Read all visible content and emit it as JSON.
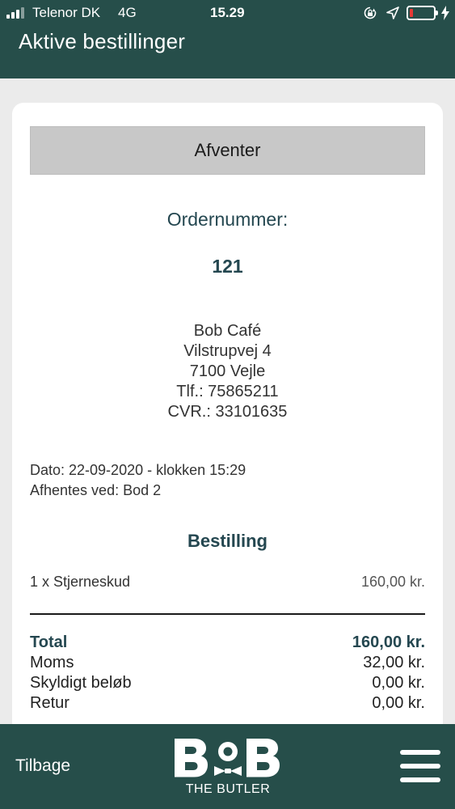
{
  "status_bar": {
    "carrier": "Telenor DK",
    "network": "4G",
    "time": "15.29",
    "battery_level": 0.15
  },
  "header": {
    "title": "Aktive bestillinger"
  },
  "order": {
    "status": "Afventer",
    "number_label": "Ordernummer:",
    "number": "121",
    "shop": {
      "name": "Bob Café",
      "street": "Vilstrupvej 4",
      "city": "7100 Vejle",
      "phone": "Tlf.: 75865211",
      "cvr": "CVR.: 33101635"
    },
    "date_line": "Dato: 22-09-2020 - klokken 15:29",
    "pickup_line": "Afhentes ved: Bod 2",
    "items_title": "Bestilling",
    "items": [
      {
        "description": "1 x Stjerneskud",
        "price": "160,00 kr."
      }
    ],
    "totals": {
      "total_label": "Total",
      "total_value": "160,00 kr.",
      "vat_label": "Moms",
      "vat_value": "32,00 kr.",
      "due_label": "Skyldigt beløb",
      "due_value": "0,00 kr.",
      "change_label": "Retur",
      "change_value": "0,00 kr."
    }
  },
  "footer": {
    "back_label": "Tilbage",
    "logo_word": "BOB",
    "logo_sub": "THE BUTLER"
  },
  "colors": {
    "brand_green": "#264e4a",
    "heading_blue": "#244750",
    "battery_low": "#e53935"
  },
  "icons": [
    "signal-icon",
    "screen-lock-icon",
    "location-arrow-icon",
    "battery-icon",
    "charging-bolt-icon",
    "menu-icon"
  ]
}
